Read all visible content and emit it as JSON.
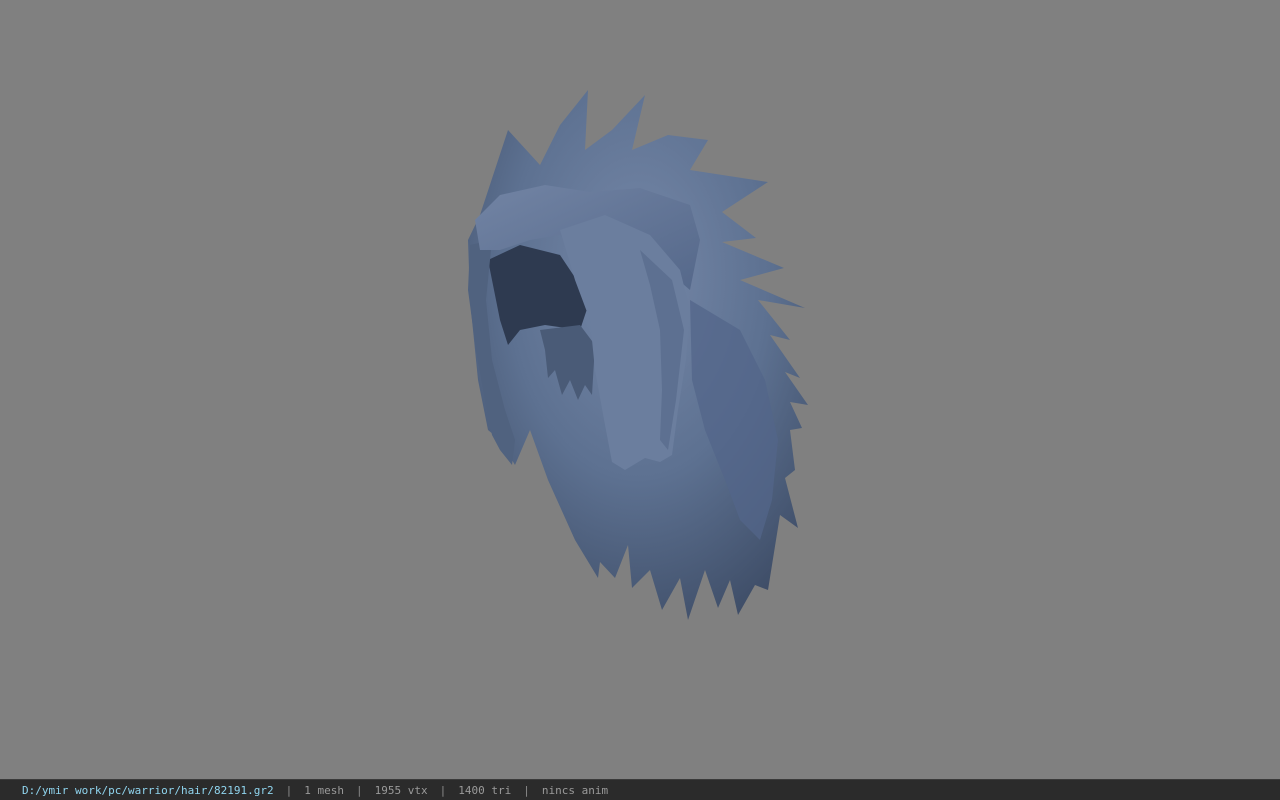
{
  "viewer": {
    "background_color": "#808080",
    "model_color": "#5f7393",
    "model_icon": "spiky-hair-mesh"
  },
  "status_bar": {
    "file_path": "D:/ymir work/pc/warrior/hair/82191.gr2",
    "separator": "|",
    "mesh_count": "1 mesh",
    "vertex_count": "1955 vtx",
    "triangle_count": "1400 tri",
    "animation": "nincs anim"
  }
}
